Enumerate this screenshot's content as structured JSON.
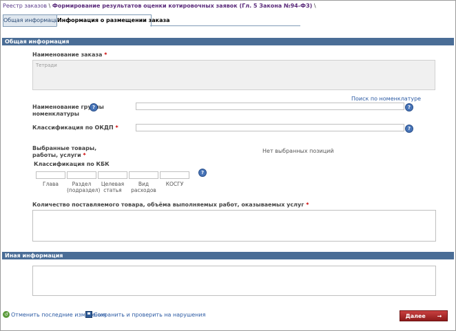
{
  "breadcrumb": {
    "root": "Реестр заказов",
    "sep1": " \\ ",
    "current": "Формирование результатов оценки котировочных заявок (Гл. 5 Закона №94-ФЗ)",
    "sep2": " \\"
  },
  "tabs": [
    {
      "label": "Общая информация",
      "active": false
    },
    {
      "label": "Информация о размещении заказа",
      "active": true
    }
  ],
  "sections": {
    "general": "Общая информация",
    "other": "Иная информация"
  },
  "form": {
    "order_name_label": "Наименование заказа",
    "order_name_value": "Тетради",
    "nomenclature_search_link": "Поиск по номенклатуре",
    "nomenclature_group_label_1": "Наименование группы",
    "nomenclature_group_label_2": "номенклатуры",
    "okdp_label": "Классификация по ОКДП",
    "selected_goods_label_1": "Выбранные товары,",
    "selected_goods_label_2": "работы, услуги",
    "no_selected": "Нет выбранных позиций",
    "kbk_label": "Классификация по КБК",
    "kbk_columns": [
      {
        "l1": "Глава",
        "l2": ""
      },
      {
        "l1": "Раздел",
        "l2": "(подраздел)"
      },
      {
        "l1": "Целевая",
        "l2": "статья"
      },
      {
        "l1": "Вид",
        "l2": "расходов"
      },
      {
        "l1": "КОСГУ",
        "l2": ""
      }
    ],
    "quantity_label": "Количество поставляемого товара, объёма выполняемых работ, оказываемых услуг",
    "required_mark": "*"
  },
  "actions": {
    "undo": "Отменить последние изменения",
    "save": "Сохранить и проверить на нарушения",
    "next": "Далее",
    "next_arrow": "→"
  },
  "colors": {
    "section_bar": "#4a6d96",
    "next_button": "#b02a2a",
    "help_icon": "#4774b8"
  }
}
